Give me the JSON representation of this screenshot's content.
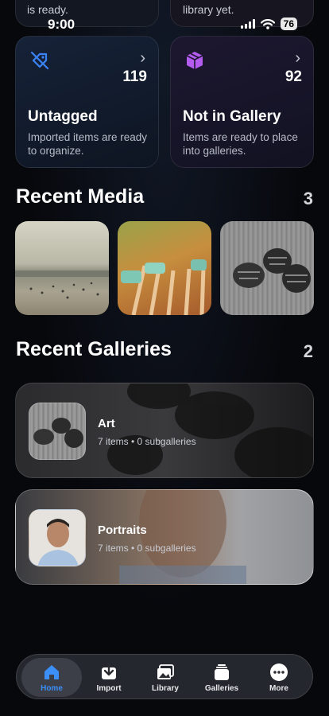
{
  "status_bar": {
    "time": "9:00",
    "battery": "76"
  },
  "previous_cards": {
    "left_text": "is ready.",
    "right_text": "library yet."
  },
  "stat_cards": [
    {
      "count": "119",
      "title": "Untagged",
      "description": "Imported items are ready to organize.",
      "icon": "tag-slash-icon",
      "accent": "#3b82f6"
    },
    {
      "count": "92",
      "title": "Not in Gallery",
      "description": "Items are ready to place into galleries.",
      "icon": "cube-icon",
      "accent": "#b45cf0"
    }
  ],
  "recent_media": {
    "title": "Recent Media",
    "count": "3",
    "items": [
      {
        "name": "beach-photo"
      },
      {
        "name": "garden-photo"
      },
      {
        "name": "pinecone-photo"
      }
    ]
  },
  "recent_galleries": {
    "title": "Recent Galleries",
    "count": "2",
    "items": [
      {
        "name": "Art",
        "meta": "7 items • 0 subgalleries"
      },
      {
        "name": "Portraits",
        "meta": "7 items • 0 subgalleries"
      }
    ]
  },
  "tab_bar": {
    "active": "Home",
    "tabs": [
      {
        "label": "Home",
        "icon": "house-icon"
      },
      {
        "label": "Import",
        "icon": "import-icon"
      },
      {
        "label": "Library",
        "icon": "photos-icon"
      },
      {
        "label": "Galleries",
        "icon": "stack-icon"
      },
      {
        "label": "More",
        "icon": "ellipsis-icon"
      }
    ]
  }
}
